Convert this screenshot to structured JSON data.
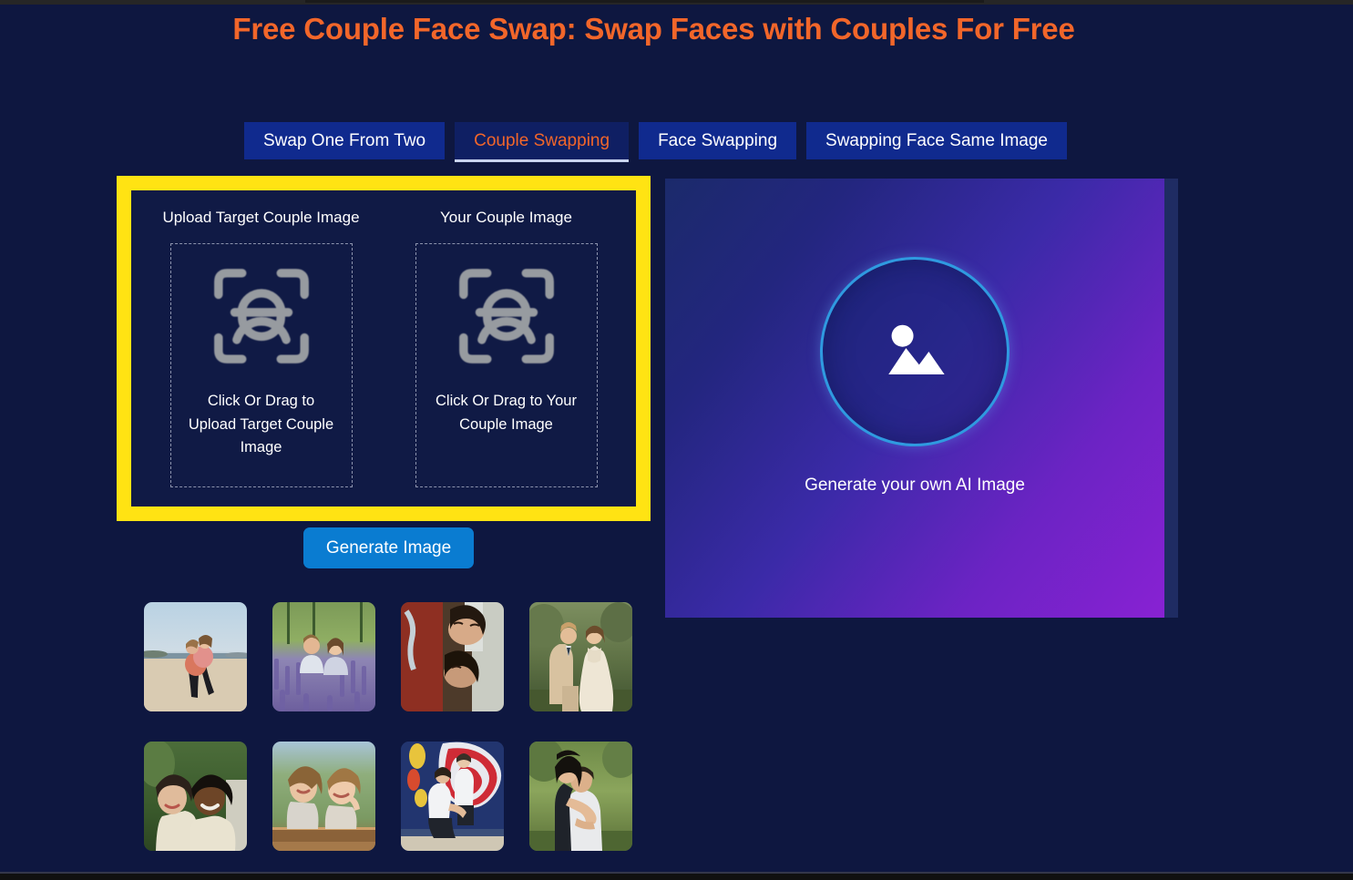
{
  "page": {
    "title": "Free Couple Face Swap: Swap Faces with Couples For Free",
    "background_color": "#0e1740",
    "title_color": "#f2662a"
  },
  "tabs": [
    {
      "label": "Swap One From Two",
      "active": false
    },
    {
      "label": "Couple Swapping",
      "active": true
    },
    {
      "label": "Face Swapping",
      "active": false
    },
    {
      "label": "Swapping Face Same Image",
      "active": false
    }
  ],
  "upload_card": {
    "highlight_color": "#ffe313",
    "slots": [
      {
        "title": "Upload Target Couple Image",
        "dropzone_text": "Click Or Drag to Upload Target Couple Image",
        "icon": "face-scan-icon"
      },
      {
        "title": "Your Couple Image",
        "dropzone_text": "Click Or Drag to Your Couple Image",
        "icon": "face-scan-icon"
      }
    ]
  },
  "actions": {
    "generate_label": "Generate Image",
    "generate_color": "#0a7cd1"
  },
  "ai_panel": {
    "caption": "Generate your own AI Image",
    "icon": "image-placeholder-icon",
    "ring_color": "#2f9ae0",
    "gradient_from": "#1b2a6b",
    "gradient_to": "#8a22d4"
  },
  "gallery": {
    "items": [
      {
        "name": "couple-piggyback-beach",
        "alt": "Couple piggyback ride on a sandy beach"
      },
      {
        "name": "couple-lavender-field",
        "alt": "Young couple sitting in a lavender field"
      },
      {
        "name": "couple-lying-down",
        "alt": "Two women lying down head to head outdoors"
      },
      {
        "name": "wedding-couple-garden",
        "alt": "Bride and groom posing in a garden"
      },
      {
        "name": "couple-portrait-park",
        "alt": "Smiling couple portrait in a park"
      },
      {
        "name": "two-children-bench",
        "alt": "Two young children leaning on a wooden bench"
      },
      {
        "name": "teens-graffiti-wall",
        "alt": "Two teenagers in front of a red graffiti wall"
      },
      {
        "name": "couple-hug-park",
        "alt": "Couple hugging outdoors in a sunlit park"
      }
    ]
  }
}
